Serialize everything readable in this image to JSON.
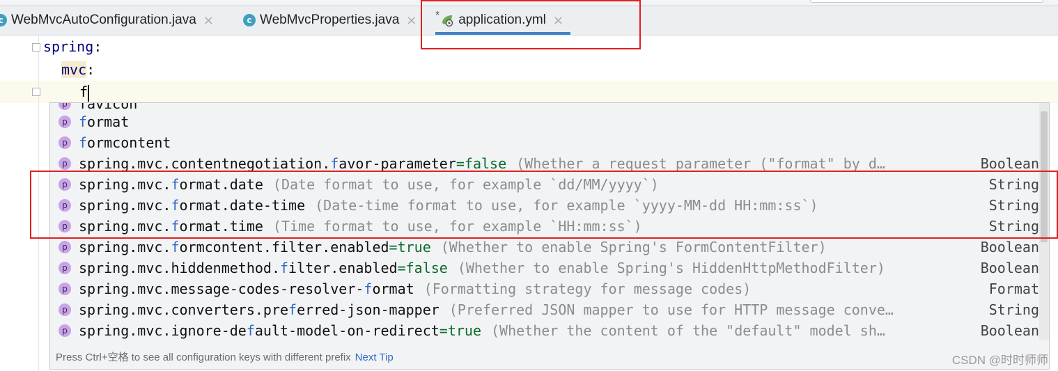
{
  "tabs": [
    {
      "label": "WebMvcAutoConfiguration.java",
      "icon": "c"
    },
    {
      "label": "WebMvcProperties.java",
      "icon": "c"
    },
    {
      "label": "application.yml",
      "modified_marker": "*"
    }
  ],
  "tab_close_glyph": "×",
  "editor": {
    "line1_key": "spring",
    "line2_key": "mvc",
    "line3_text": "f",
    "colon": ":"
  },
  "completion": {
    "partial_item": "favicon",
    "items": [
      {
        "pre": "",
        "match": "f",
        "post": "ormat",
        "default": "",
        "desc": "",
        "type": ""
      },
      {
        "pre": "",
        "match": "f",
        "post": "ormcontent",
        "default": "",
        "desc": "",
        "type": ""
      },
      {
        "pre": "spring.mvc.contentnegotiation.",
        "match": "f",
        "post": "avor-parameter",
        "default": "=false",
        "desc": "(Whether a request parameter (\"format\" by d…",
        "type": "Boolean"
      },
      {
        "pre": "spring.mvc.",
        "match": "f",
        "post": "ormat.date",
        "default": "",
        "desc": "(Date format to use, for example `dd/MM/yyyy`)",
        "type": "String"
      },
      {
        "pre": "spring.mvc.",
        "match": "f",
        "post": "ormat.date-time",
        "default": "",
        "desc": "(Date-time format to use, for example `yyyy-MM-dd HH:mm:ss`)",
        "type": "String"
      },
      {
        "pre": "spring.mvc.",
        "match": "f",
        "post": "ormat.time",
        "default": "",
        "desc": "(Time format to use, for example `HH:mm:ss`)",
        "type": "String"
      },
      {
        "pre": "spring.mvc.",
        "match": "f",
        "post": "ormcontent.filter.enabled",
        "default": "=true",
        "desc": "(Whether to enable Spring's FormContentFilter)",
        "type": "Boolean"
      },
      {
        "pre": "spring.mvc.hiddenmethod.",
        "match": "f",
        "post": "ilter.enabled",
        "default": "=false",
        "desc": "(Whether to enable Spring's HiddenHttpMethodFilter)",
        "type": "Boolean"
      },
      {
        "pre": "spring.mvc.message-codes-resolver-",
        "match": "f",
        "post": "ormat",
        "default": "",
        "desc": "(Formatting strategy for message codes)",
        "type": "Format"
      },
      {
        "pre": "spring.mvc.converters.pre",
        "match": "f",
        "post": "erred-json-mapper",
        "default": "",
        "desc": "(Preferred JSON mapper to use for HTTP message conve…",
        "type": "String"
      },
      {
        "pre": "spring.mvc.ignore-de",
        "match": "f",
        "post": "ault-model-on-redirect",
        "default": "=true",
        "desc": "(Whether the content of the \"default\" model sh…",
        "type": "Boolean"
      }
    ],
    "item_icon_letter": "p",
    "footer_text": "Press Ctrl+空格 to see all configuration keys with different prefix",
    "footer_link": "Next Tip"
  },
  "watermark": "CSDN @时时师师",
  "colors": {
    "accent": "#4083c9",
    "annotation_red": "#e02020",
    "match_blue": "#2f68c6"
  }
}
